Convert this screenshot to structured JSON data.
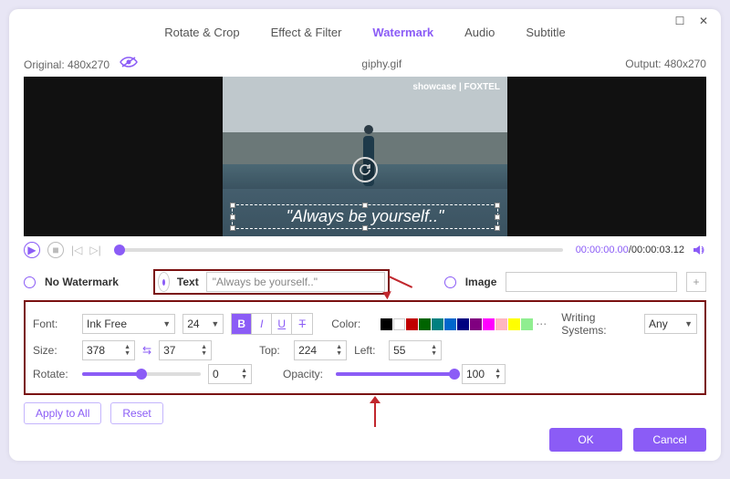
{
  "titlebar": {
    "max": "☐",
    "close": "✕"
  },
  "tabs": [
    "Rotate & Crop",
    "Effect & Filter",
    "Watermark",
    "Audio",
    "Subtitle"
  ],
  "active_tab": "Watermark",
  "info": {
    "original_label": "Original: 480x270",
    "filename": "giphy.gif",
    "output_label": "Output: 480x270"
  },
  "preview": {
    "badge": "showcase | FOXTEL",
    "watermark_text": "\"Always be yourself..\""
  },
  "playback": {
    "time_current": "00:00:00.00",
    "time_total": "00:00:03.12"
  },
  "wm": {
    "none": "No Watermark",
    "text": "Text",
    "text_value": "\"Always be yourself..\"",
    "image": "Image",
    "add": "+"
  },
  "panel": {
    "font_label": "Font:",
    "font": "Ink Free",
    "font_size": "24",
    "color_label": "Color:",
    "colors": [
      "#000000",
      "#ffffff",
      "#c00000",
      "#006400",
      "#008080",
      "#0066cc",
      "#000080",
      "#800080",
      "#ff00ff",
      "#ffb6c1",
      "#ffff00",
      "#90ee90"
    ],
    "ws_label": "Writing Systems:",
    "ws": "Any",
    "size_label": "Size:",
    "w": "378",
    "h": "37",
    "top_label": "Top:",
    "top": "224",
    "left_label": "Left:",
    "left": "55",
    "rotate_label": "Rotate:",
    "rotate": "0",
    "opacity_label": "Opacity:",
    "opacity": "100"
  },
  "buttons": {
    "apply": "Apply to All",
    "reset": "Reset",
    "ok": "OK",
    "cancel": "Cancel"
  }
}
